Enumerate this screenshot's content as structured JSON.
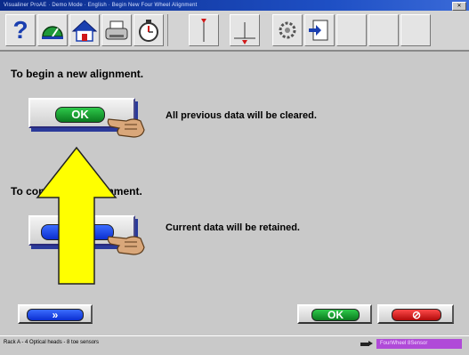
{
  "window": {
    "title": "Visualiner ProAE · Demo Mode · English · Begin New Four Wheel Alignment"
  },
  "toolbar": {
    "help_glyph": "?",
    "icons": [
      "help-icon",
      "gauge-icon",
      "home-icon",
      "printer-icon",
      "timer-icon",
      "pointer-icon",
      "alignment-icon",
      "sensor-icon",
      "report-icon"
    ]
  },
  "main": {
    "new_heading": "To begin a new alignment.",
    "new_button_label": "OK",
    "new_desc": "All previous data will be cleared.",
    "continue_heading": "To continue an alignment.",
    "continue_desc": "Current data will be retained."
  },
  "bottom": {
    "next_label": "»",
    "ok_label": "OK",
    "cancel_label": "⊘"
  },
  "status": {
    "left_text": "Rack A - 4 Optical heads - 8 toe sensors",
    "right_badge": "FourWheel 8Sensor"
  },
  "colors": {
    "accent_blue": "#1a3fb0",
    "ok_green": "#0b7a1f",
    "cancel_red": "#d01818",
    "arrow_yellow": "#ffff00"
  }
}
